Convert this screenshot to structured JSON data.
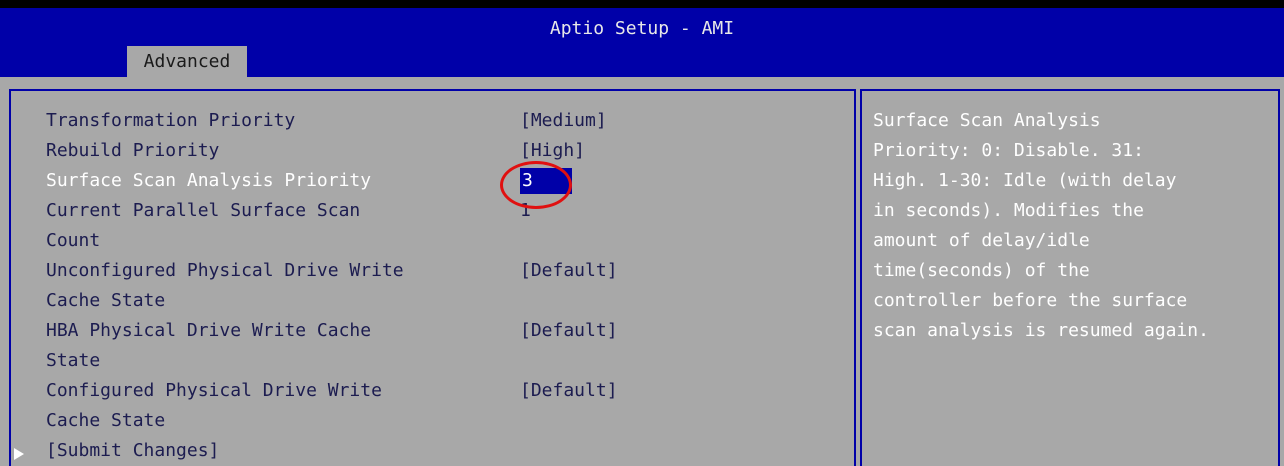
{
  "title": "Aptio Setup - AMI",
  "tabs": [
    {
      "label": "Advanced",
      "active": true
    }
  ],
  "settings": [
    {
      "label": "Transformation Priority",
      "value": "[Medium]"
    },
    {
      "label": "Rebuild Priority",
      "value": "[High]"
    },
    {
      "label": "Surface Scan Analysis Priority",
      "value": "3",
      "selected": true
    },
    {
      "label_lines": [
        "Current Parallel Surface Scan",
        "Count"
      ],
      "value": "1"
    },
    {
      "label_lines": [
        "Unconfigured Physical Drive Write",
        "Cache State"
      ],
      "value": "[Default]"
    },
    {
      "label_lines": [
        "HBA Physical Drive Write Cache",
        "State"
      ],
      "value": "[Default]"
    },
    {
      "label_lines": [
        "Configured Physical Drive Write",
        "Cache State"
      ],
      "value": "[Default]"
    }
  ],
  "submenu": {
    "label": "[Submit Changes]",
    "icon": "submenu-arrow-icon"
  },
  "help_lines": [
    "Surface Scan Analysis",
    "Priority: 0: Disable. 31:",
    "High. 1-30: Idle (with delay",
    "in seconds). Modifies the",
    "amount of delay/idle",
    "time(seconds) of the",
    "controller before the surface",
    "scan analysis is resumed again."
  ],
  "colors": {
    "header_bg": "#0000a8",
    "panel_bg": "#a8a8a8",
    "highlight_bg": "#0000a8",
    "text": "#1c1c50",
    "selected_text": "#ffffff",
    "annotation": "#e01010"
  }
}
